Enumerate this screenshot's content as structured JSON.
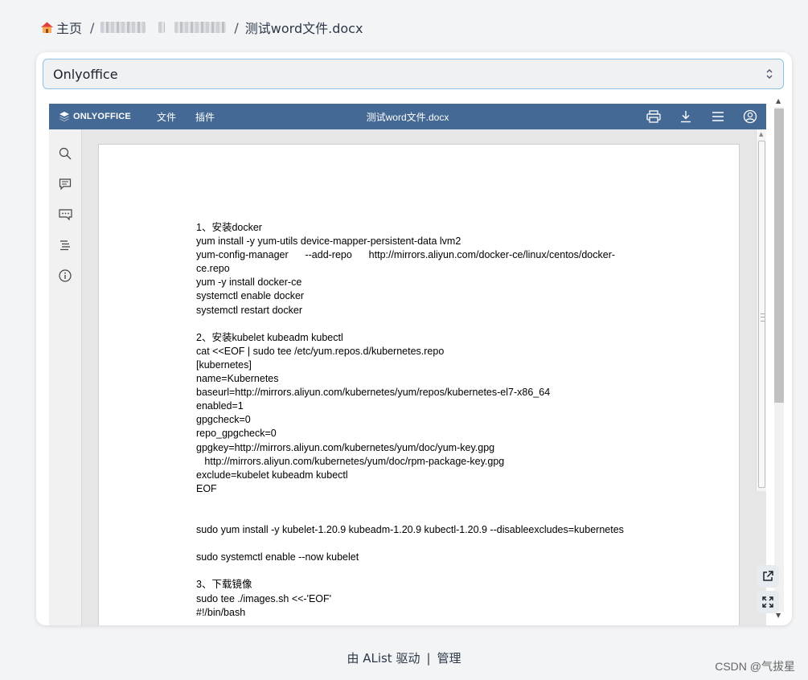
{
  "breadcrumb": {
    "home_label": "主页",
    "separator": "/",
    "current_file": "测试word文件.docx"
  },
  "viewer_select": {
    "selected": "Onlyoffice"
  },
  "editor": {
    "brand": "ONLYOFFICE",
    "menu": [
      "文件",
      "插件"
    ],
    "doc_title": "测试word文件.docx",
    "header_color": "#446995",
    "toolbar_icons": [
      "print-icon",
      "download-icon",
      "menu-icon",
      "user-icon"
    ],
    "sidebar_icons": [
      "search-icon",
      "comment-icon",
      "chat-icon",
      "navigation-icon",
      "info-icon"
    ]
  },
  "document": {
    "lines": [
      "1、安装docker",
      "yum install -y yum-utils device-mapper-persistent-data lvm2",
      "yum-config-manager      --add-repo      http://mirrors.aliyun.com/docker-ce/linux/centos/docker-",
      "ce.repo",
      "yum -y install docker-ce",
      "systemctl enable docker",
      "systemctl restart docker",
      "",
      "2、安装kubelet kubeadm kubectl",
      "cat <<EOF | sudo tee /etc/yum.repos.d/kubernetes.repo",
      "[kubernetes]",
      "name=Kubernetes",
      "baseurl=http://mirrors.aliyun.com/kubernetes/yum/repos/kubernetes-el7-x86_64",
      "enabled=1",
      "gpgcheck=0",
      "repo_gpgcheck=0",
      "gpgkey=http://mirrors.aliyun.com/kubernetes/yum/doc/yum-key.gpg",
      "   http://mirrors.aliyun.com/kubernetes/yum/doc/rpm-package-key.gpg",
      "exclude=kubelet kubeadm kubectl",
      "EOF",
      "",
      "",
      "sudo yum install -y kubelet-1.20.9 kubeadm-1.20.9 kubectl-1.20.9 --disableexcludes=kubernetes",
      "",
      "sudo systemctl enable --now kubelet",
      "",
      "3、下载镜像",
      "sudo tee ./images.sh <<-'EOF'",
      "#!/bin/bash"
    ]
  },
  "footer": {
    "powered_by": "由 AList 驱动",
    "separator": "|",
    "manage": "管理"
  },
  "watermark": "CSDN @气拔星"
}
